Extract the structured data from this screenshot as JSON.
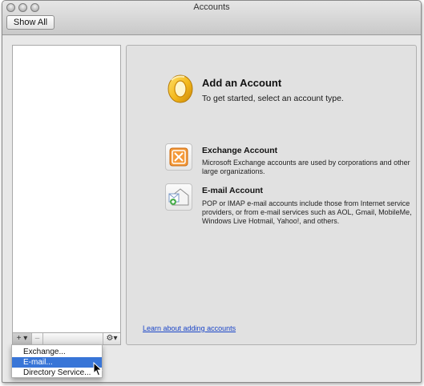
{
  "window": {
    "title": "Accounts"
  },
  "toolbar": {
    "show_all_label": "Show All"
  },
  "sidebar_tools": {
    "add_label": "+ ▾",
    "remove_label": "–",
    "gear_label": "⚙▾"
  },
  "main": {
    "title": "Add an Account",
    "subtitle": "To get started, select an account type.",
    "options": [
      {
        "title": "Exchange Account",
        "description": "Microsoft Exchange accounts are used by corporations and other large organizations.",
        "icon": "exchange-icon",
        "accent": "#f59a3a"
      },
      {
        "title": "E-mail Account",
        "description": "POP or IMAP e-mail accounts include those from Internet service providers, or from e-mail services such as AOL, Gmail, MobileMe, Windows Live Hotmail, Yahoo!, and others.",
        "icon": "email-account-icon"
      }
    ],
    "learn_link": "Learn about adding accounts"
  },
  "menu": {
    "items": [
      {
        "label": "Exchange..."
      },
      {
        "label": "E-mail...",
        "selected": true
      },
      {
        "label": "Directory Service..."
      }
    ]
  },
  "colors": {
    "selection": "#3875d7",
    "link": "#1a45c8",
    "outlook_brand": "#f3b81c"
  }
}
